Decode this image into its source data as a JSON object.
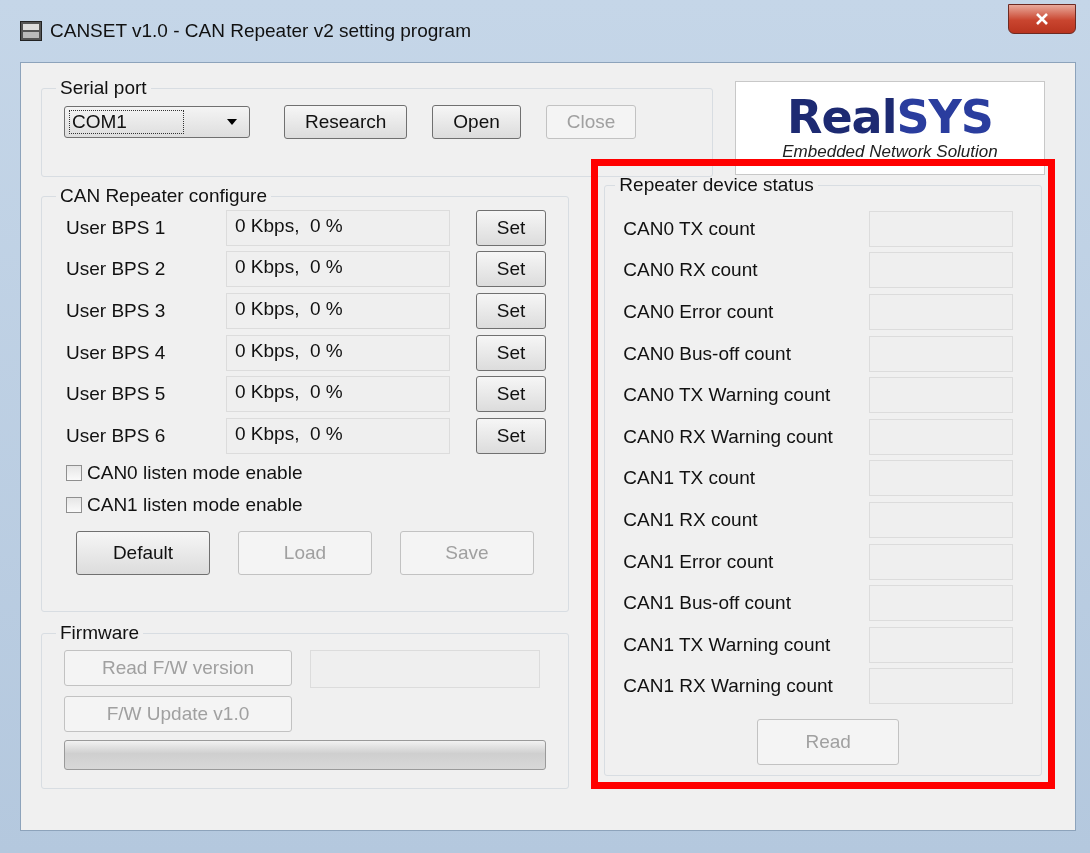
{
  "window": {
    "title": "CANSET v1.0 - CAN Repeater v2 setting program"
  },
  "serial_port": {
    "title": "Serial port",
    "port": {
      "value": "COM1"
    },
    "buttons": [
      {
        "label": "Research",
        "disabled": false
      },
      {
        "label": "Open",
        "disabled": false
      },
      {
        "label": "Close",
        "disabled": true
      }
    ]
  },
  "logo": {
    "name_start": "Real",
    "name_end": "SYS",
    "tagline": "Embedded Network Solution"
  },
  "configure": {
    "title": "CAN Repeater configure",
    "rows": [
      {
        "label": "User BPS 1",
        "value": "0 Kbps,  0 %",
        "button": "Set"
      },
      {
        "label": "User BPS 2",
        "value": "0 Kbps,  0 %",
        "button": "Set"
      },
      {
        "label": "User BPS 3",
        "value": "0 Kbps,  0 %",
        "button": "Set"
      },
      {
        "label": "User BPS 4",
        "value": "0 Kbps,  0 %",
        "button": "Set"
      },
      {
        "label": "User BPS 5",
        "value": "0 Kbps,  0 %",
        "button": "Set"
      },
      {
        "label": "User BPS 6",
        "value": "0 Kbps,  0 %",
        "button": "Set"
      }
    ],
    "checkboxes": [
      {
        "label": "CAN0 listen mode enable",
        "checked": false
      },
      {
        "label": "CAN1 listen mode enable",
        "checked": false
      }
    ],
    "buttons": [
      {
        "label": "Default",
        "disabled": false
      },
      {
        "label": "Load",
        "disabled": true
      },
      {
        "label": "Save",
        "disabled": true
      }
    ]
  },
  "firmware": {
    "title": "Firmware",
    "buttons": [
      {
        "label": "Read F/W version",
        "disabled": true
      },
      {
        "label": "F/W Update v1.0",
        "disabled": true
      }
    ],
    "progress": {
      "level": 0
    }
  },
  "status": {
    "title": "Repeater device status",
    "rows": [
      {
        "label": "CAN0 TX count"
      },
      {
        "label": "CAN0 RX count"
      },
      {
        "label": "CAN0 Error count"
      },
      {
        "label": "CAN0 Bus-off count"
      },
      {
        "label": "CAN0 TX Warning count"
      },
      {
        "label": "CAN0 RX Warning count"
      },
      {
        "label": "CAN1 TX count"
      },
      {
        "label": "CAN1 RX count"
      },
      {
        "label": "CAN1 Error count"
      },
      {
        "label": "CAN1 Bus-off count"
      },
      {
        "label": "CAN1 TX Warning count"
      },
      {
        "label": "CAN1 RX Warning count"
      }
    ],
    "button": {
      "label": "Read",
      "disabled": true
    }
  }
}
